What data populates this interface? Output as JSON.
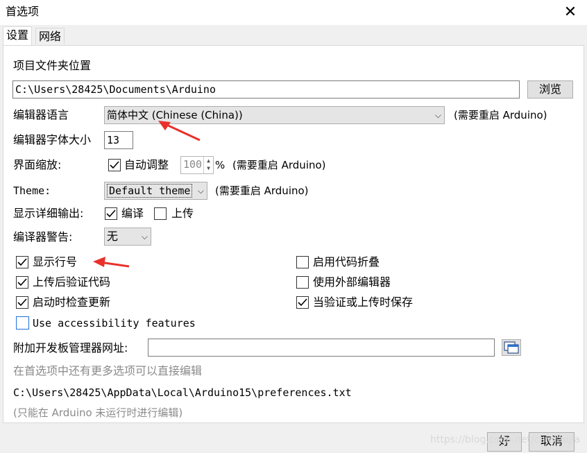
{
  "window": {
    "title": "首选项",
    "close_glyph": "✕"
  },
  "tabs": [
    {
      "label": "设置"
    },
    {
      "label": "网络"
    }
  ],
  "sketchbook": {
    "label": "项目文件夹位置",
    "path": "C:\\Users\\28425\\Documents\\Arduino",
    "browse_label": "浏览"
  },
  "editor_language": {
    "label": "编辑器语言",
    "value": "简体中文 (Chinese (China))",
    "note": "(需要重启 Arduino)"
  },
  "editor_font_size": {
    "label": "编辑器字体大小",
    "value": "13"
  },
  "interface_scale": {
    "label": "界面缩放:",
    "auto_label": "自动调整",
    "auto_checked": true,
    "value": "100",
    "unit": "%",
    "note": "(需要重启 Arduino)"
  },
  "theme": {
    "label": "Theme:",
    "value": "Default theme",
    "note": "(需要重启 Arduino)"
  },
  "verbose_output": {
    "label": "显示详细输出:",
    "compile_label": "编译",
    "compile_checked": true,
    "upload_label": "上传",
    "upload_checked": false
  },
  "compiler_warnings": {
    "label": "编译器警告:",
    "value": "无"
  },
  "options_left": [
    {
      "label": "显示行号",
      "checked": true
    },
    {
      "label": "上传后验证代码",
      "checked": true
    },
    {
      "label": "启动时检查更新",
      "checked": true
    }
  ],
  "options_right": [
    {
      "label": "启用代码折叠",
      "checked": false
    },
    {
      "label": "使用外部编辑器",
      "checked": false
    },
    {
      "label": "当验证或上传时保存",
      "checked": true
    }
  ],
  "accessibility": {
    "label": "Use accessibility features",
    "checked": false
  },
  "board_manager": {
    "label": "附加开发板管理器网址:",
    "value": ""
  },
  "more_prefs_hint": "在首选项中还有更多选项可以直接编辑",
  "prefs_path": "C:\\Users\\28425\\AppData\\Local\\Arduino15\\preferences.txt",
  "edit_hint": "(只能在 Arduino 未运行时进行编辑)",
  "buttons": {
    "ok_label": "好",
    "cancel_label": "取消"
  },
  "watermark": "https://blog.csdn.net/cainiaojia",
  "colors": {
    "annotation_arrow": "#e8312a",
    "accent_check": "#1e6fd9"
  }
}
